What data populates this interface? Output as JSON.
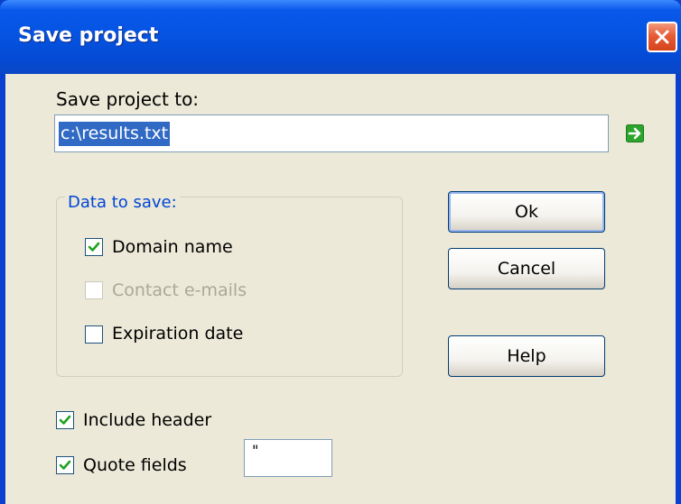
{
  "window": {
    "title": "Save project"
  },
  "save_to": {
    "label": "Save project to:",
    "value": "c:\\results.txt"
  },
  "data_group": {
    "legend": "Data to save:",
    "options": [
      {
        "label": "Domain name",
        "checked": true,
        "enabled": true
      },
      {
        "label": "Contact e-mails",
        "checked": false,
        "enabled": false
      },
      {
        "label": "Expiration date",
        "checked": false,
        "enabled": true
      }
    ]
  },
  "include_header": {
    "label": "Include header",
    "checked": true
  },
  "quote_fields": {
    "label": "Quote fields",
    "checked": true,
    "quote_char": "\""
  },
  "buttons": {
    "ok": "Ok",
    "cancel": "Cancel",
    "help": "Help"
  },
  "colors": {
    "titlebar": "#0553e0",
    "client_bg": "#ece9d8",
    "group_legend": "#0046d5",
    "selection": "#316ac5",
    "check_mark": "#21a121",
    "go_arrow": "#2da52d"
  },
  "icons": {
    "close": "close-icon",
    "go": "arrow-right-icon",
    "check": "check-icon"
  }
}
